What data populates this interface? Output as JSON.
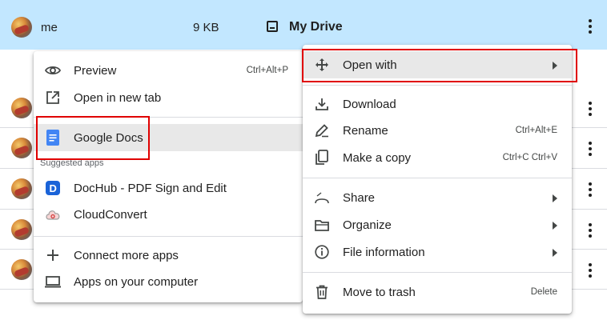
{
  "file_list": {
    "selected_row": {
      "owner": "me",
      "size": "9 KB",
      "location": "My Drive"
    }
  },
  "left_menu": {
    "items": [
      {
        "label": "Preview",
        "shortcut": "Ctrl+Alt+P",
        "icon": "eye-icon"
      },
      {
        "label": "Open in new tab",
        "icon": "open-in-new-icon"
      }
    ],
    "suggested_app": {
      "label": "Google Docs",
      "icon": "google-docs-icon"
    },
    "suggested_label": "Suggested apps",
    "apps": [
      {
        "label": "DocHub - PDF Sign and Edit",
        "icon": "dochub-icon"
      },
      {
        "label": "CloudConvert",
        "icon": "cloudconvert-icon"
      }
    ],
    "bottom": [
      {
        "label": "Connect more apps",
        "icon": "plus-icon"
      },
      {
        "label": "Apps on your computer",
        "icon": "laptop-icon"
      }
    ]
  },
  "right_menu": {
    "open_with": {
      "label": "Open with",
      "icon": "move-arrows-icon"
    },
    "items": [
      {
        "label": "Download",
        "icon": "download-icon"
      },
      {
        "label": "Rename",
        "shortcut": "Ctrl+Alt+E",
        "icon": "pencil-icon"
      },
      {
        "label": "Make a copy",
        "shortcut": "Ctrl+C Ctrl+V",
        "icon": "copy-icon"
      }
    ],
    "submenus": [
      {
        "label": "Share",
        "icon": "share-icon"
      },
      {
        "label": "Organize",
        "icon": "folder-icon"
      },
      {
        "label": "File information",
        "icon": "info-icon"
      }
    ],
    "trash": {
      "label": "Move to trash",
      "shortcut": "Delete",
      "icon": "trash-icon"
    }
  },
  "colors": {
    "selected_row": "#c2e7ff",
    "highlight_box": "#e00000",
    "hover": "#e8e8e8",
    "docs_blue": "#4285f4",
    "dochub_blue": "#1a63d8"
  }
}
